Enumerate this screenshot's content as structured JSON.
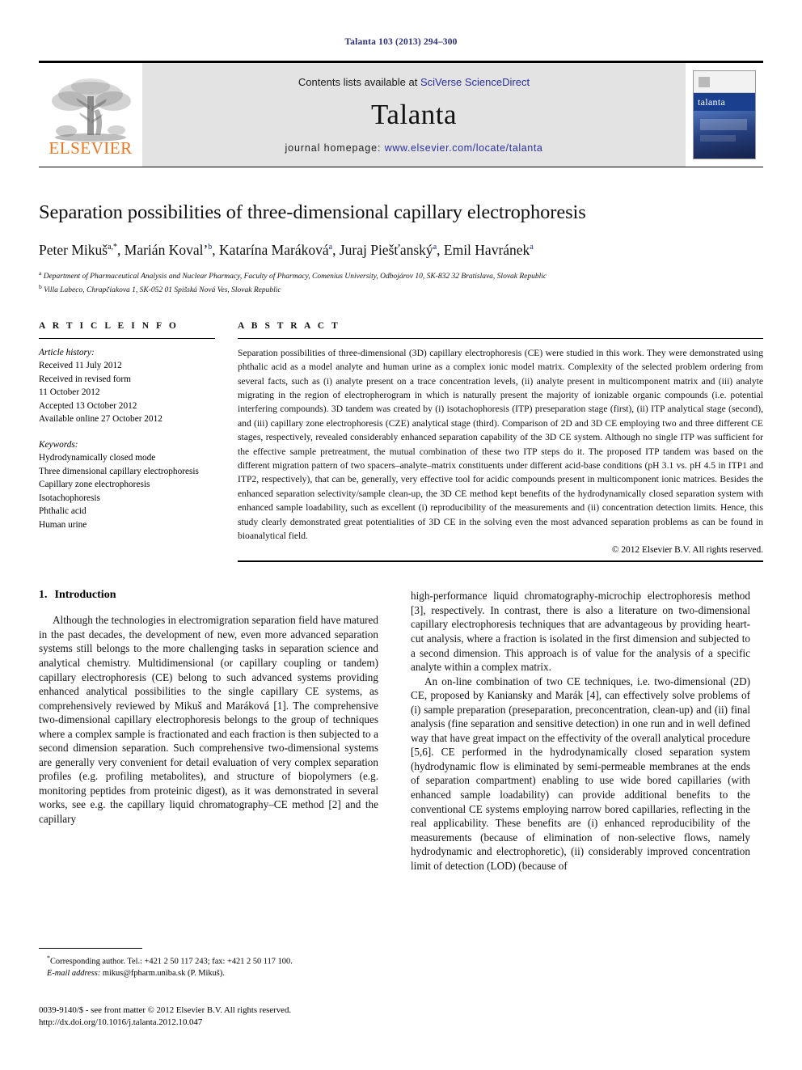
{
  "running_head": "Talanta 103 (2013) 294–300",
  "masthead": {
    "publisher_logo_name": "ELSEVIER",
    "contents_prefix": "Contents lists available at ",
    "contents_link": "SciVerse ScienceDirect",
    "journal_name": "Talanta",
    "homepage_prefix": "journal homepage: ",
    "homepage_link": "www.elsevier.com/locate/talanta",
    "cover_title": "talanta"
  },
  "article": {
    "title": "Separation possibilities of three-dimensional capillary electrophoresis",
    "authors": [
      {
        "name": "Peter Mikuš",
        "marks": "a,*"
      },
      {
        "name": "Marián Koval’",
        "marks": "b"
      },
      {
        "name": "Katarína Maráková",
        "marks": "a"
      },
      {
        "name": "Juraj Piešťanský",
        "marks": "a"
      },
      {
        "name": "Emil Havránek",
        "marks": "a"
      }
    ],
    "affiliations": [
      {
        "mark": "a",
        "text": "Department of Pharmaceutical Analysis and Nuclear Pharmacy, Faculty of Pharmacy, Comenius University, Odbojárov 10, SK-832 32 Bratislava, Slovak Republic"
      },
      {
        "mark": "b",
        "text": "Villa Labeco, Chrapčiakova 1, SK-052 01 Spišská Nová Ves, Slovak Republic"
      }
    ]
  },
  "article_info": {
    "heading": "A R T I C L E  I N F O",
    "history_label": "Article history:",
    "history": [
      "Received 11 July 2012",
      "Received in revised form",
      "11 October 2012",
      "Accepted 13 October 2012",
      "Available online 27 October 2012"
    ],
    "keywords_label": "Keywords:",
    "keywords": [
      "Hydrodynamically closed mode",
      "Three dimensional capillary electrophoresis",
      "Capillary zone electrophoresis",
      "Isotachophoresis",
      "Phthalic acid",
      "Human urine"
    ]
  },
  "abstract": {
    "heading": "A B S T R A C T",
    "text": "Separation possibilities of three-dimensional (3D) capillary electrophoresis (CE) were studied in this work. They were demonstrated using phthalic acid as a model analyte and human urine as a complex ionic model matrix. Complexity of the selected problem ordering from several facts, such as (i) analyte present on a trace concentration levels, (ii) analyte present in multicomponent matrix and (iii) analyte migrating in the region of electropherogram in which is naturally present the majority of ionizable organic compounds (i.e. potential interfering compounds). 3D tandem was created by (i) isotachophoresis (ITP) preseparation stage (first), (ii) ITP analytical stage (second), and (iii) capillary zone electrophoresis (CZE) analytical stage (third). Comparison of 2D and 3D CE employing two and three different CE stages, respectively, revealed considerably enhanced separation capability of the 3D CE system. Although no single ITP was sufficient for the effective sample pretreatment, the mutual combination of these two ITP steps do it. The proposed ITP tandem was based on the different migration pattern of two spacers–analyte–matrix constituents under different acid-base conditions (pH 3.1 vs. pH 4.5 in ITP1 and ITP2, respectively), that can be, generally, very effective tool for acidic compounds present in multicomponent ionic matrices. Besides the enhanced separation selectivity/sample clean-up, the 3D CE method kept benefits of the hydrodynamically closed separation system with enhanced sample loadability, such as excellent (i) reproducibility of the measurements and (ii) concentration detection limits. Hence, this study clearly demonstrated great potentialities of 3D CE in the solving even the most advanced separation problems as can be found in bioanalytical field.",
    "copyright": "© 2012 Elsevier B.V. All rights reserved."
  },
  "introduction": {
    "number": "1.",
    "heading": "Introduction",
    "left_paragraphs": [
      "Although the technologies in electromigration separation field have matured in the past decades, the development of new, even more advanced separation systems still belongs to the more challenging tasks in separation science and analytical chemistry. Multidimensional (or capillary coupling or tandem) capillary electrophoresis (CE) belong to such advanced systems providing enhanced analytical possibilities to the single capillary CE systems, as comprehensively reviewed by Mikuš and Maráková [1]. The comprehensive two-dimensional capillary electrophoresis belongs to the group of techniques where a complex sample is fractionated and each fraction is then subjected to a second dimension separation. Such comprehensive two-dimensional systems are generally very convenient for detail evaluation of very complex separation profiles (e.g. profiling metabolites), and structure of biopolymers (e.g. monitoring peptides from proteinic digest), as it was demonstrated in several works, see e.g. the capillary liquid chromatography–CE method [2] and the capillary"
    ],
    "right_paragraphs": [
      "high-performance liquid chromatography-microchip electrophoresis method [3], respectively. In contrast, there is also a literature on two-dimensional capillary electrophoresis techniques that are advantageous by providing heart-cut analysis, where a fraction is isolated in the first dimension and subjected to a second dimension. This approach is of value for the analysis of a specific analyte within a complex matrix.",
      "An on-line combination of two CE techniques, i.e. two-dimensional (2D) CE, proposed by Kaniansky and Marák [4], can effectively solve problems of (i) sample preparation (preseparation, preconcentration, clean-up) and (ii) final analysis (fine separation and sensitive detection) in one run and in well defined way that have great impact on the effectivity of the overall analytical procedure [5,6]. CE performed in the hydrodynamically closed separation system (hydrodynamic flow is eliminated by semi-permeable membranes at the ends of separation compartment) enabling to use wide bored capillaries (with enhanced sample loadability) can provide additional benefits to the conventional CE systems employing narrow bored capillaries, reflecting in the real applicability. These benefits are (i) enhanced reproducibility of the measurements (because of elimination of non-selective flows, namely hydrodynamic and electrophoretic), (ii) considerably improved concentration limit of detection (LOD) (because of"
    ]
  },
  "footnote": {
    "corresponding": "Corresponding author. Tel.: +421 2 50 117 243; fax: +421 2 50 117 100.",
    "email_label": "E-mail address:",
    "email": "mikus@fpharm.uniba.sk (P. Mikuš)."
  },
  "footer": {
    "issn_line": "0039-9140/$ - see front matter © 2012 Elsevier B.V. All rights reserved.",
    "doi_line": "http://dx.doi.org/10.1016/j.talanta.2012.10.047"
  },
  "colors": {
    "link": "#2b2f9e",
    "running_head": "#2b2f7a",
    "reference": "#1c2a86",
    "cover_band": "#1b3f8f",
    "elsevier_orange": "#e87722"
  }
}
